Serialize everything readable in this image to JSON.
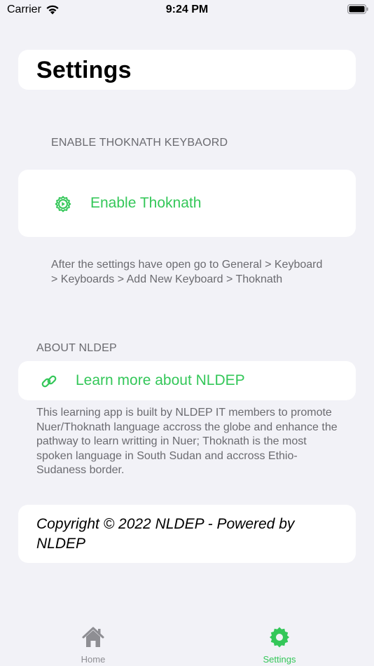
{
  "status_bar": {
    "carrier": "Carrier",
    "time": "9:24 PM",
    "wifi_icon": "wifi-icon",
    "battery_icon": "battery-icon"
  },
  "page": {
    "title": "Settings"
  },
  "keyboard_section": {
    "header": "ENABLE THOKNATH KEYBAORD",
    "enable_label": "Enable Thoknath",
    "enable_icon": "gear-icon",
    "footer": "After the settings have open go to General > Keyboard > Keyboards > Add New Keyboard > Thoknath"
  },
  "about_section": {
    "header": "ABOUT NLDEP",
    "learn_more_label": "Learn more about NLDEP",
    "learn_more_icon": "link-icon",
    "footer": "This learning app is built by NLDEP IT members to promote Nuer/Thoknath language accross the globe and enhance the pathway to learn writting in Nuer; Thoknath is the most spoken language in South Sudan and accross Ethio-Sudaness border."
  },
  "copyright": {
    "text": "Copyright © 2022 NLDEP - Powered by NLDEP"
  },
  "tab_bar": {
    "tabs": [
      {
        "label": "Home",
        "icon": "house-icon",
        "selected": false
      },
      {
        "label": "Settings",
        "icon": "gear-icon",
        "selected": true
      }
    ]
  },
  "colors": {
    "accent": "#34c759",
    "background": "#f2f2f7",
    "secondary_text": "#6b6b70",
    "inactive_tab": "#8e8e93"
  }
}
